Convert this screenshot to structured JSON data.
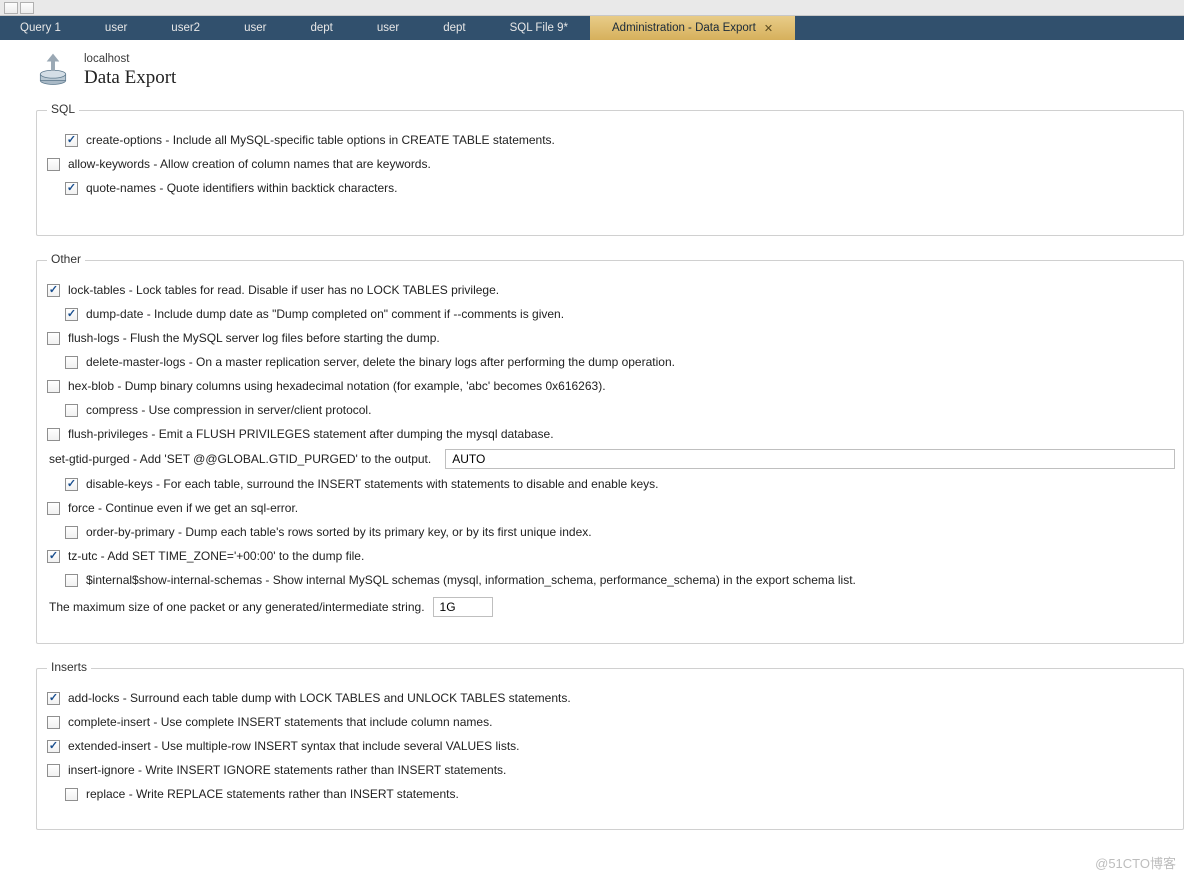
{
  "tabs": [
    {
      "label": "Query 1"
    },
    {
      "label": "user"
    },
    {
      "label": "user2"
    },
    {
      "label": "user"
    },
    {
      "label": "dept"
    },
    {
      "label": "user"
    },
    {
      "label": "dept"
    },
    {
      "label": "SQL File 9*"
    },
    {
      "label": "Administration - Data Export",
      "active": true,
      "closable": true
    }
  ],
  "header": {
    "host": "localhost",
    "title": "Data Export"
  },
  "groups": {
    "sql": {
      "legend": "SQL",
      "options": [
        {
          "name": "create-options",
          "checked": true,
          "indent": 1,
          "label": "create-options - Include all MySQL-specific table options in CREATE TABLE statements."
        },
        {
          "name": "allow-keywords",
          "checked": false,
          "indent": 0,
          "label": "allow-keywords - Allow creation of column names that are keywords."
        },
        {
          "name": "quote-names",
          "checked": true,
          "indent": 1,
          "label": "quote-names - Quote identifiers within backtick characters."
        }
      ]
    },
    "other": {
      "legend": "Other",
      "options": [
        {
          "name": "lock-tables",
          "checked": true,
          "indent": 0,
          "label": "lock-tables - Lock tables for read. Disable if user has no LOCK TABLES privilege."
        },
        {
          "name": "dump-date",
          "checked": true,
          "indent": 1,
          "label": "dump-date - Include dump date as \"Dump completed on\" comment if --comments is given."
        },
        {
          "name": "flush-logs",
          "checked": false,
          "indent": 0,
          "label": "flush-logs - Flush the MySQL server log files before starting the dump."
        },
        {
          "name": "delete-master-logs",
          "checked": false,
          "indent": 1,
          "label": "delete-master-logs - On a master replication server, delete the binary logs after performing the dump operation."
        },
        {
          "name": "hex-blob",
          "checked": false,
          "indent": 0,
          "label": "hex-blob - Dump binary columns using hexadecimal notation (for example, 'abc' becomes 0x616263)."
        },
        {
          "name": "compress",
          "checked": false,
          "indent": 1,
          "label": "compress - Use compression in server/client protocol."
        },
        {
          "name": "flush-privileges",
          "checked": false,
          "indent": 0,
          "label": "flush-privileges - Emit a FLUSH PRIVILEGES statement after dumping the mysql database."
        }
      ],
      "set_gtid_label": "set-gtid-purged - Add 'SET @@GLOBAL.GTID_PURGED' to the output.",
      "set_gtid_value": "AUTO",
      "options2": [
        {
          "name": "disable-keys",
          "checked": true,
          "indent": 1,
          "label": "disable-keys - For each table, surround the INSERT statements with statements to disable and enable keys."
        },
        {
          "name": "force",
          "checked": false,
          "indent": 0,
          "label": "force - Continue even if we get an sql-error."
        },
        {
          "name": "order-by-primary",
          "checked": false,
          "indent": 1,
          "label": "order-by-primary - Dump each table's rows sorted by its primary key, or by its first unique index."
        },
        {
          "name": "tz-utc",
          "checked": true,
          "indent": 0,
          "label": "tz-utc - Add SET TIME_ZONE='+00:00' to the dump file."
        },
        {
          "name": "show-internal-schemas",
          "checked": false,
          "indent": 1,
          "label": "$internal$show-internal-schemas - Show internal MySQL schemas (mysql, information_schema, performance_schema) in the export schema list."
        }
      ],
      "max_packet_label": "The maximum size of one packet or any generated/intermediate string.",
      "max_packet_value": "1G"
    },
    "inserts": {
      "legend": "Inserts",
      "options": [
        {
          "name": "add-locks",
          "checked": true,
          "indent": 0,
          "label": "add-locks - Surround each table dump with LOCK TABLES and UNLOCK TABLES statements."
        },
        {
          "name": "complete-insert",
          "checked": false,
          "indent": 0,
          "label": "complete-insert - Use complete INSERT statements that include column names."
        },
        {
          "name": "extended-insert",
          "checked": true,
          "indent": 0,
          "label": "extended-insert - Use multiple-row INSERT syntax that include several VALUES lists."
        },
        {
          "name": "insert-ignore",
          "checked": false,
          "indent": 0,
          "label": "insert-ignore - Write INSERT IGNORE statements rather than INSERT statements."
        },
        {
          "name": "replace",
          "checked": false,
          "indent": 1,
          "label": "replace - Write REPLACE statements rather than INSERT statements."
        }
      ]
    }
  },
  "watermark": "@51CTO博客"
}
